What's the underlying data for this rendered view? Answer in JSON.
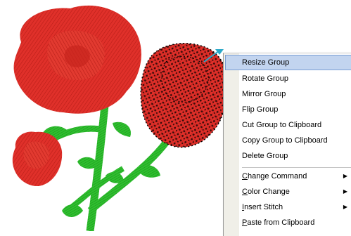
{
  "canvas": {
    "colors": {
      "rose_red": "#e0302a",
      "rose_dark": "#a11712",
      "leaf_green": "#2fbf2f",
      "stem_green": "#1e9a1e",
      "selection_dots": "#000000",
      "selection_handle": "#2aa8c8"
    }
  },
  "context_menu": {
    "items": [
      {
        "label": "Resize Group",
        "highlighted": true
      },
      {
        "label": "Rotate Group"
      },
      {
        "label": "Mirror Group"
      },
      {
        "label": "Flip Group"
      },
      {
        "label": "Cut Group to Clipboard"
      },
      {
        "label": "Copy Group to Clipboard"
      },
      {
        "label": "Delete Group"
      }
    ],
    "submenus": [
      {
        "label": "Change Command",
        "mnemonic": "C",
        "rest": "hange Command",
        "has_submenu": true
      },
      {
        "label": "Color Change",
        "mnemonic": "C",
        "rest": "olor Change",
        "has_submenu": true
      },
      {
        "label": "Insert Stitch",
        "mnemonic": "I",
        "rest": "nsert Stitch",
        "has_submenu": true
      },
      {
        "label": "Paste from Clipboard",
        "mnemonic": "P",
        "rest": "aste from Clipboard",
        "has_submenu": false
      }
    ],
    "submenu_arrow": "▶"
  }
}
